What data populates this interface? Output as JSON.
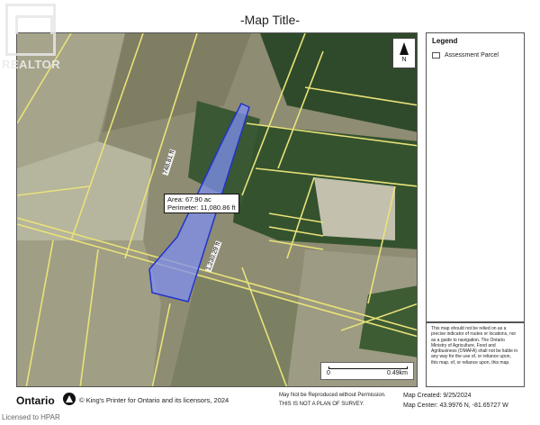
{
  "map": {
    "title": "-Map Title-",
    "north_label": "N",
    "area_label": "Area: 67.90 ac",
    "perimeter_label": "Perimeter: 11,080.86 ft",
    "dimension_a": "748.81 ft",
    "dimension_b": "1,230.29 ft",
    "parcel_outline_color": "#2233cc",
    "parcel_fill_color": "#7f8ff0",
    "lot_line_color": "#e9e27a"
  },
  "watermark": {
    "brand": "REALTOR"
  },
  "legend": {
    "title": "Legend",
    "items": [
      {
        "label": "Assessment Parcel"
      }
    ]
  },
  "disclaimer": {
    "text": "This map should not be relied on as a precise indicator of routes or locations, nor as a guide to navigation. The Ontario Ministry of Agriculture, Food and Agribusiness (OMAFA) shall not be liable in any way for the use of, or reliance upon, this map. of, or reliance upon, this map."
  },
  "scale": {
    "start": "0",
    "end": "0.49km"
  },
  "footer": {
    "ontario": "Ontario",
    "copyright": "© King's Printer for Ontario and its licensors, 2024",
    "not_reproduced": "May Not be Reproduced without Permission.",
    "not_survey": "THIS IS NOT A PLAN OF SURVEY.",
    "map_created": "Map Created: 9/25/2024",
    "map_center": "Map Center: 43.9976 N, -81.65727 W"
  },
  "licensed": "Licensed to HPAR"
}
